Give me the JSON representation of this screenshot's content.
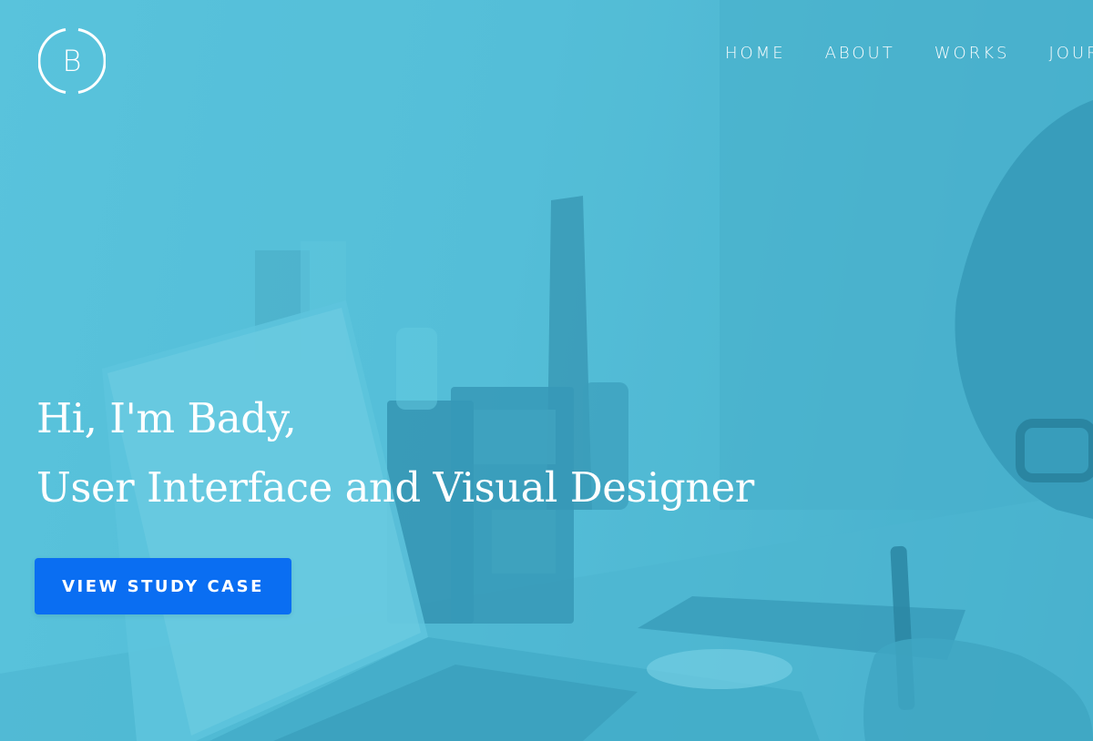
{
  "brand": {
    "logo_letter": "B",
    "logo_icon": "circle-b-logo"
  },
  "nav": {
    "items": [
      {
        "label": "HOME"
      },
      {
        "label": "ABOUT"
      },
      {
        "label": "WORKS"
      },
      {
        "label": "JOURNAL"
      }
    ]
  },
  "hero": {
    "greeting": "Hi, I'm Bady,",
    "title": "User Interface and Visual Designer",
    "cta_label": "VIEW STUDY CASE",
    "background_image": "desk-workspace-photo"
  },
  "colors": {
    "overlay": "#55bdd6",
    "cta": "#0a6ef2",
    "text": "#ffffff"
  }
}
